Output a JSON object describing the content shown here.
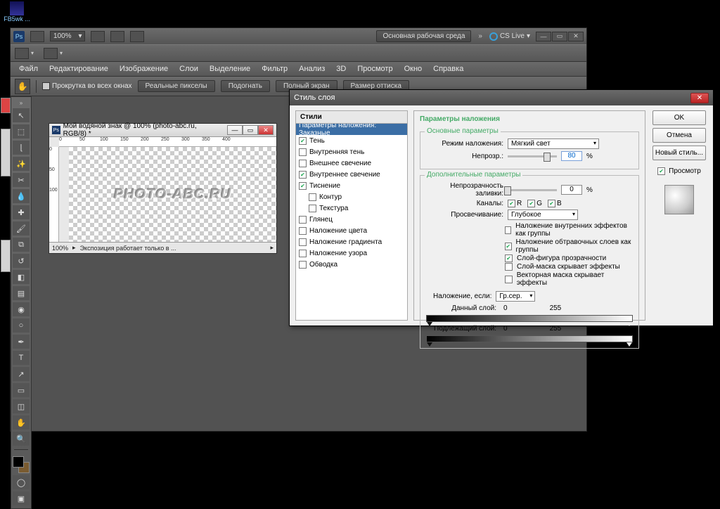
{
  "taskbar": {
    "label": "FB5wk ..."
  },
  "app": {
    "icon": "Ps",
    "zoom": "100%",
    "workspace_btn": "Основная рабочая среда",
    "cs_live": "CS Live",
    "menu": [
      "Файл",
      "Редактирование",
      "Изображение",
      "Слои",
      "Выделение",
      "Фильтр",
      "Анализ",
      "3D",
      "Просмотр",
      "Окно",
      "Справка"
    ],
    "options": {
      "scroll_all": "Прокрутка во всех окнах",
      "btn_real_px": "Реальные пикселы",
      "btn_fit": "Подогнать",
      "btn_full": "Полный экран",
      "btn_print": "Размер оттиска"
    }
  },
  "doc": {
    "title": "Мой водяной знак @ 100% (photo-abc.ru, RGB/8) *",
    "watermark_text": "PHOTO-ABC.RU",
    "ruler_h": [
      "0",
      "50",
      "100",
      "150",
      "200",
      "250",
      "300",
      "350",
      "400"
    ],
    "ruler_v": [
      "0",
      "50",
      "100"
    ],
    "status_zoom": "100%",
    "status_info": "Экспозиция работает только в ..."
  },
  "dialog": {
    "title": "Стиль слоя",
    "styles_head": "Стили",
    "effects": [
      {
        "label": "Параметры наложения: Заказные",
        "checked": false,
        "selected": true
      },
      {
        "label": "Тень",
        "checked": true
      },
      {
        "label": "Внутренняя тень",
        "checked": false
      },
      {
        "label": "Внешнее свечение",
        "checked": false
      },
      {
        "label": "Внутреннее свечение",
        "checked": true
      },
      {
        "label": "Тиснение",
        "checked": true
      },
      {
        "label": "Контур",
        "checked": false,
        "indent": true
      },
      {
        "label": "Текстура",
        "checked": false,
        "indent": true
      },
      {
        "label": "Глянец",
        "checked": false
      },
      {
        "label": "Наложение цвета",
        "checked": false
      },
      {
        "label": "Наложение градиента",
        "checked": false
      },
      {
        "label": "Наложение узора",
        "checked": false
      },
      {
        "label": "Обводка",
        "checked": false
      }
    ],
    "params": {
      "heading": "Параметры наложения",
      "basic_legend": "Основные параметры",
      "blend_mode_label": "Режим наложения:",
      "blend_mode_value": "Мягкий свет",
      "opacity_label": "Непрозр.:",
      "opacity_value": "80",
      "opacity_unit": "%",
      "adv_legend": "Дополнительные параметры",
      "fill_opacity_label": "Непрозрачность заливки:",
      "fill_opacity_value": "0",
      "fill_opacity_unit": "%",
      "channels_label": "Каналы:",
      "channels": [
        "R",
        "G",
        "B"
      ],
      "knockout_label": "Просвечивание:",
      "knockout_value": "Глубокое",
      "opts": [
        {
          "checked": false,
          "label": "Наложение внутренних эффектов как группы"
        },
        {
          "checked": true,
          "label": "Наложение обтравочных слоев как группы"
        },
        {
          "checked": true,
          "label": "Слой-фигура прозрачности"
        },
        {
          "checked": false,
          "label": "Слой-маска скрывает эффекты"
        },
        {
          "checked": false,
          "label": "Векторная маска скрывает эффекты"
        }
      ],
      "blendif_label": "Наложение, если:",
      "blendif_value": "Гр.сер.",
      "this_layer_label": "Данный слой:",
      "this_layer_lo": "0",
      "this_layer_hi": "255",
      "under_layer_label": "Подлежащий слой:",
      "under_layer_lo": "0",
      "under_layer_hi": "255"
    },
    "buttons": {
      "ok": "OK",
      "cancel": "Отмена",
      "new_style": "Новый стиль...",
      "preview": "Просмотр"
    }
  }
}
